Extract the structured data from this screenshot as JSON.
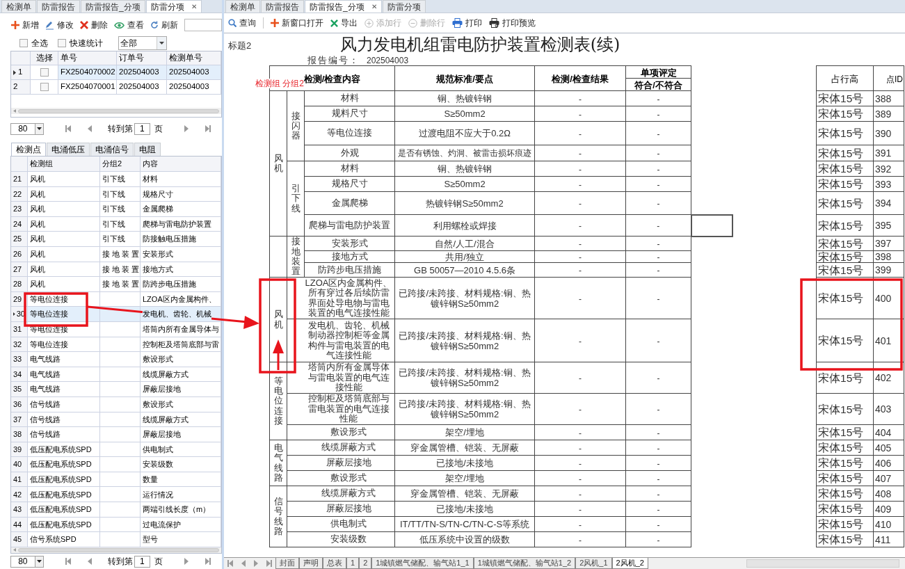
{
  "left_pane": {
    "tabs": [
      {
        "label": "检测单",
        "selected": false
      },
      {
        "label": "防雷报告",
        "selected": false
      },
      {
        "label": "防雷报告_分项",
        "selected": false
      },
      {
        "label": "防雷分项",
        "selected": true,
        "close": "✕"
      }
    ],
    "toolbar": [
      {
        "label": "新增",
        "kind": "add"
      },
      {
        "label": "修改",
        "kind": "edit"
      },
      {
        "label": "删除",
        "kind": "delete"
      },
      {
        "label": "查看",
        "kind": "view"
      },
      {
        "label": "刷新",
        "kind": "refresh"
      }
    ],
    "filters": {
      "select_all": {
        "label": "全选",
        "checked": false
      },
      "quick_stats": {
        "label": "快速统计",
        "checked": false
      },
      "dropdown": "全部"
    },
    "orders": {
      "columns": [
        "选择",
        "单号",
        "订单号",
        "检测单号"
      ],
      "rows": [
        {
          "index": "1",
          "selected": true,
          "checked": false,
          "order_no": "FX2504070002",
          "order": "202504003",
          "test_no": "202504003"
        },
        {
          "index": "2",
          "selected": false,
          "checked": false,
          "order_no": "FX2504070001",
          "order": "202504003",
          "test_no": "202504003"
        }
      ]
    },
    "pager": {
      "page_size": "80",
      "goto_label": "转到第",
      "page": "1",
      "page_unit": "页"
    },
    "detail_tabs": [
      {
        "label": "检测点",
        "selected": true
      },
      {
        "label": "电涌低压",
        "selected": false
      },
      {
        "label": "电涌信号",
        "selected": false
      },
      {
        "label": "电阻",
        "selected": false
      }
    ],
    "points": {
      "columns": [
        "检测组",
        "分组2",
        "内容"
      ],
      "rows": [
        {
          "index": "21",
          "group": "风机",
          "sub": "引下线",
          "content": "材料",
          "selected": false
        },
        {
          "index": "22",
          "group": "风机",
          "sub": "引下线",
          "content": "规格尺寸",
          "selected": false
        },
        {
          "index": "23",
          "group": "风机",
          "sub": "引下线",
          "content": "金属爬梯",
          "selected": false
        },
        {
          "index": "24",
          "group": "风机",
          "sub": "引下线",
          "content": "爬梯与雷电防护装置",
          "selected": false
        },
        {
          "index": "25",
          "group": "风机",
          "sub": "引下线",
          "content": "防接触电压措施",
          "selected": false
        },
        {
          "index": "26",
          "group": "风机",
          "sub": "接 地 装 置",
          "content": "安装形式",
          "selected": false
        },
        {
          "index": "27",
          "group": "风机",
          "sub": "接 地 装 置",
          "content": "接地方式",
          "selected": false
        },
        {
          "index": "28",
          "group": "风机",
          "sub": "接 地 装 置",
          "content": "防跨步电压措施",
          "selected": false
        },
        {
          "index": "29",
          "group": "等电位连接",
          "content": "LZOA区内金属构件、",
          "selected": false
        },
        {
          "index": "30",
          "group": "等电位连接",
          "content": "发电机、齿轮、机械",
          "selected": true
        },
        {
          "index": "31",
          "group": "等电位连接",
          "content": "塔筒内所有金属导体与",
          "selected": false
        },
        {
          "index": "32",
          "group": "等电位连接",
          "content": "控制柜及塔筒底部与雷",
          "selected": false
        },
        {
          "index": "33",
          "group": "电气线路",
          "content": "敷设形式",
          "selected": false
        },
        {
          "index": "34",
          "group": "电气线路",
          "content": "线缆屏蔽方式",
          "selected": false
        },
        {
          "index": "35",
          "group": "电气线路",
          "content": "屏蔽层接地",
          "selected": false
        },
        {
          "index": "36",
          "group": "信号线路",
          "content": "敷设形式",
          "selected": false
        },
        {
          "index": "37",
          "group": "信号线路",
          "content": "线缆屏蔽方式",
          "selected": false
        },
        {
          "index": "38",
          "group": "信号线路",
          "content": "屏蔽层接地",
          "selected": false
        },
        {
          "index": "39",
          "group": "低压配电系统SPD",
          "content": "供电制式",
          "selected": false
        },
        {
          "index": "40",
          "group": "低压配电系统SPD",
          "content": "安装级数",
          "selected": false
        },
        {
          "index": "41",
          "group": "低压配电系统SPD",
          "content": "数量",
          "selected": false
        },
        {
          "index": "42",
          "group": "低压配电系统SPD",
          "content": "运行情况",
          "selected": false
        },
        {
          "index": "43",
          "group": "低压配电系统SPD",
          "content": "两端引线长度（m）",
          "selected": false
        },
        {
          "index": "44",
          "group": "低压配电系统SPD",
          "content": "过电流保护",
          "selected": false
        },
        {
          "index": "45",
          "group": "信号系统SPD",
          "content": "型号",
          "selected": false
        }
      ]
    },
    "pager2": {
      "page_size": "80",
      "goto_label": "转到第",
      "page": "1",
      "page_unit": "页"
    }
  },
  "right_pane": {
    "tabs": [
      {
        "label": "检测单",
        "selected": false
      },
      {
        "label": "防雷报告",
        "selected": false
      },
      {
        "label": "防雷报告_分项",
        "selected": true,
        "close": "✕"
      },
      {
        "label": "防雷分项",
        "selected": false
      }
    ],
    "toolbar": [
      {
        "label": "查询",
        "kind": "search",
        "disabled": false
      },
      {
        "kind": "separator"
      },
      {
        "label": "新窗口打开",
        "kind": "add",
        "disabled": false
      },
      {
        "label": "导出",
        "kind": "export",
        "disabled": false
      },
      {
        "label": "添加行",
        "kind": "add_row",
        "disabled": true
      },
      {
        "label": "删除行",
        "kind": "delete_row",
        "disabled": true
      },
      {
        "label": "打印",
        "kind": "print",
        "disabled": false
      },
      {
        "label": "打印预览",
        "kind": "print_preview",
        "disabled": false
      }
    ],
    "report": {
      "corner_label": "标题2",
      "title": "风力发电机组雷电防护装置检测表(续)",
      "number_label": "报告编号：",
      "number": "202504003",
      "annotation": "检测组 分组2",
      "header": {
        "content": "检测/检查内容",
        "standard": "规范标准/要点",
        "result": "检测/检查结果",
        "judgment": "单项评定",
        "judgment_sub": "符合/不符合",
        "row_height": "占行高",
        "point_id": "点ID"
      },
      "groups": [
        {
          "name": "风机",
          "subgroups": [
            {
              "name": "接闪器",
              "items": [
                {
                  "item": "材料",
                  "standard": "铜、热镀锌钢",
                  "result": "-",
                  "judgment": "-",
                  "font": "宋体15号",
                  "point_id": "388",
                  "selected": false
                },
                {
                  "item": "规料尺寸",
                  "standard": "S≥50mm2",
                  "result": "-",
                  "judgment": "-",
                  "font": "宋体15号",
                  "point_id": "389",
                  "selected": false
                },
                {
                  "item": "等电位连接",
                  "standard": "过渡电阻不应大于0.2Ω",
                  "result": "-",
                  "judgment": "-",
                  "font": "宋体15号",
                  "point_id": "390",
                  "selected": false
                },
                {
                  "item": "外观",
                  "standard": "是否有锈蚀、灼洞、被雷击损坏痕迹",
                  "result": "-",
                  "judgment": "-",
                  "font": "宋体15号",
                  "point_id": "391",
                  "selected": false
                }
              ]
            },
            {
              "name": "引下线",
              "items": [
                {
                  "item": "材料",
                  "standard": "铜、热镀锌钢",
                  "result": "-",
                  "judgment": "-",
                  "font": "宋体15号",
                  "point_id": "392",
                  "selected": false
                },
                {
                  "item": "规格尺寸",
                  "standard": "S≥50mm2",
                  "result": "-",
                  "judgment": "-",
                  "font": "宋体15号",
                  "point_id": "393",
                  "selected": false
                },
                {
                  "item": "金属爬梯",
                  "standard": "热镀锌钢S≥50mm2",
                  "result": "-",
                  "judgment": "-",
                  "font": "宋体15号",
                  "point_id": "394",
                  "selected": false
                },
                {
                  "item": "爬梯与雷电防护装置",
                  "standard": "利用螺栓或焊接",
                  "result": "-",
                  "judgment": "-",
                  "font": "宋体15号",
                  "point_id": "395",
                  "selected": true
                }
              ]
            }
          ]
        },
        {
          "subgroups": [
            {
              "name": "接地装置",
              "items": [
                {
                  "item": "安装形式",
                  "standard": "自然/人工/混合",
                  "result": "-",
                  "judgment": "-",
                  "font": "宋体15号",
                  "point_id": "397",
                  "selected": false
                },
                {
                  "item": "接地方式",
                  "standard": "共用/独立",
                  "result": "-",
                  "judgment": "-",
                  "font": "宋体15号",
                  "point_id": "398",
                  "selected": false
                },
                {
                  "item": "防跨步电压措施",
                  "standard": "GB 50057—2010 4.5.6条",
                  "result": "-",
                  "judgment": "-",
                  "font": "宋体15号",
                  "point_id": "399",
                  "selected": false
                }
              ]
            }
          ]
        },
        {
          "name": "风机",
          "items": [
            {
              "item": "LZOA区内金属构件、所有穿过各后续防雷界面处导电物与雷电装置的电气连接性能",
              "standard": "已跨接/未跨接、材料规格:铜、热镀锌钢S≥50mm2",
              "result": "-",
              "judgment": "-",
              "font": "宋体15号",
              "point_id": "400",
              "selected": false
            },
            {
              "item": "发电机、齿轮、机械制动器控制柜等金属构件与雷电装置的电气连接性能",
              "standard": "已跨接/未跨接、材料规格:铜、热镀锌钢S≥50mm2",
              "result": "-",
              "judgment": "-",
              "font": "宋体15号",
              "point_id": "401",
              "selected": false
            }
          ]
        },
        {
          "name": "等电位连接",
          "items": [
            {
              "item": "塔筒内所有金属导体与雷电装置的电气连接性能",
              "standard": "已跨接/未跨接、材料规格:铜、热镀锌钢S≥50mm2",
              "result": "-",
              "judgment": "-",
              "font": "宋体15号",
              "point_id": "402",
              "selected": false
            },
            {
              "item": "控制柜及塔筒底部与雷电装置的电气连接性能",
              "standard": "已跨接/未跨接、材料规格:铜、热镀锌钢S≥50mm2",
              "result": "-",
              "judgment": "-",
              "font": "宋体15号",
              "point_id": "403",
              "selected": false
            },
            {
              "item": "敷设形式",
              "standard": "架空/埋地",
              "result": "-",
              "judgment": "-",
              "font": "宋体15号",
              "point_id": "404",
              "selected": false
            }
          ]
        },
        {
          "name": "电气线路",
          "items": [
            {
              "item": "线缆屏蔽方式",
              "standard": "穿金属管槽、铠装、无屏蔽",
              "result": "-",
              "judgment": "-",
              "font": "宋体15号",
              "point_id": "405",
              "selected": false
            },
            {
              "item": "屏蔽层接地",
              "standard": "已接地/未接地",
              "result": "-",
              "judgment": "-",
              "font": "宋体15号",
              "point_id": "406",
              "selected": false
            },
            {
              "item": "敷设形式",
              "standard": "架空/埋地",
              "result": "-",
              "judgment": "-",
              "font": "宋体15号",
              "point_id": "407",
              "selected": false
            }
          ]
        },
        {
          "name": "信号线路",
          "items": [
            {
              "item": "线缆屏蔽方式",
              "standard": "穿金属管槽、铠装、无屏蔽",
              "result": "-",
              "judgment": "-",
              "font": "宋体15号",
              "point_id": "408",
              "selected": false
            },
            {
              "item": "屏蔽层接地",
              "standard": "已接地/未接地",
              "result": "-",
              "judgment": "-",
              "font": "宋体15号",
              "point_id": "409",
              "selected": false
            },
            {
              "item": "供电制式",
              "standard": "IT/TT/TN-S/TN-C/TN-C-S等系统",
              "result": "-",
              "judgment": "-",
              "font": "宋体15号",
              "point_id": "410",
              "selected": false
            },
            {
              "item": "安装级数",
              "standard": "低压系统中设置的级数",
              "result": "-",
              "judgment": "-",
              "font": "宋体15号",
              "point_id": "411",
              "selected": false
            }
          ]
        }
      ]
    },
    "sheet_tabs": [
      {
        "label": "封面",
        "selected": false
      },
      {
        "label": "声明",
        "selected": false
      },
      {
        "label": "总表",
        "selected": false
      },
      {
        "label": "1",
        "selected": false
      },
      {
        "label": "2",
        "selected": false
      },
      {
        "label": "1城镇燃气储配、输气站1_1",
        "selected": false
      },
      {
        "label": "1城镇燃气储配、输气站1_2",
        "selected": false
      },
      {
        "label": "2风机_1",
        "selected": false
      },
      {
        "label": "2风机_2",
        "selected": true
      }
    ]
  }
}
